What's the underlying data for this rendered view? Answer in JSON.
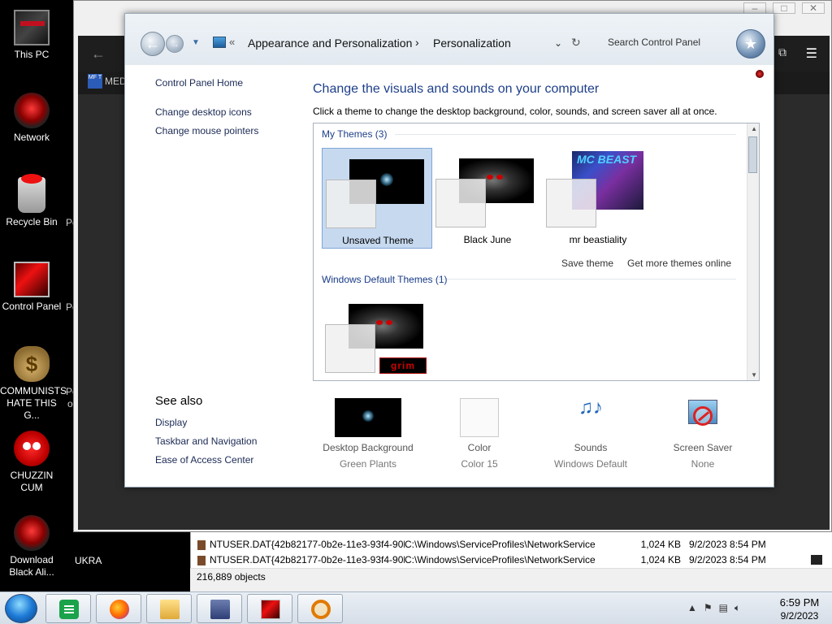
{
  "desktop": {
    "icons": [
      {
        "label": "This PC"
      },
      {
        "label": "Network"
      },
      {
        "label": "Recycle Bin"
      },
      {
        "label": "Control Panel"
      },
      {
        "label": "COMMUNISTS HATE THIS G..."
      },
      {
        "label": "CHUZZIN CUM"
      },
      {
        "label": "Download Black Ali..."
      }
    ],
    "side_labels": [
      "Pe",
      "Pe",
      "Pe",
      "o"
    ]
  },
  "background_window": {
    "tab_label": "MED",
    "tab_icon_text": "MF T",
    "ukra_label": "UKRA"
  },
  "explorer": {
    "rows": [
      {
        "name": "NTUSER.DAT{42b82177-0b2e-11e3-93f4-90b...",
        "path": "C:\\Windows\\ServiceProfiles\\NetworkService",
        "size": "1,024 KB",
        "date": "9/2/2023 8:54 PM"
      },
      {
        "name": "NTUSER.DAT{42b82177-0b2e-11e3-93f4-90b...",
        "path": "C:\\Windows\\ServiceProfiles\\NetworkService",
        "size": "1,024 KB",
        "date": "9/2/2023 8:54 PM"
      }
    ],
    "status": "216,889 objects"
  },
  "control_panel": {
    "breadcrumb": {
      "root_sep": "«",
      "item1": "Appearance and Personalization",
      "sep": "›",
      "item2": "Personalization"
    },
    "search_placeholder": "Search Control Panel",
    "left_pane": {
      "links": [
        "Control Panel Home",
        "Change desktop icons",
        "Change mouse pointers"
      ],
      "see_also_title": "See also",
      "see_also_links": [
        "Display",
        "Taskbar and Navigation",
        "Ease of Access Center"
      ]
    },
    "main": {
      "title": "Change the visuals and sounds on your computer",
      "subtitle": "Click a theme to change the desktop background, color, sounds, and screen saver all at once.",
      "my_themes_header": "My Themes (3)",
      "themes": [
        {
          "name": "Unsaved Theme",
          "selected": true
        },
        {
          "name": "Black June",
          "selected": false
        },
        {
          "name": "mr beastiality",
          "selected": false
        }
      ],
      "beast_wall_text": "MC BEAST",
      "save_theme": "Save theme",
      "get_more": "Get more themes online",
      "default_header": "Windows Default Themes (1)",
      "grim_tag": "grim",
      "settings": [
        {
          "label": "Desktop Background",
          "value": "Green Plants"
        },
        {
          "label": "Color",
          "value": "Color 15"
        },
        {
          "label": "Sounds",
          "value": "Windows Default"
        },
        {
          "label": "Screen Saver",
          "value": "None"
        }
      ]
    }
  },
  "taskbar": {
    "clock_time": "6:59 PM",
    "clock_date": "9/2/2023"
  }
}
